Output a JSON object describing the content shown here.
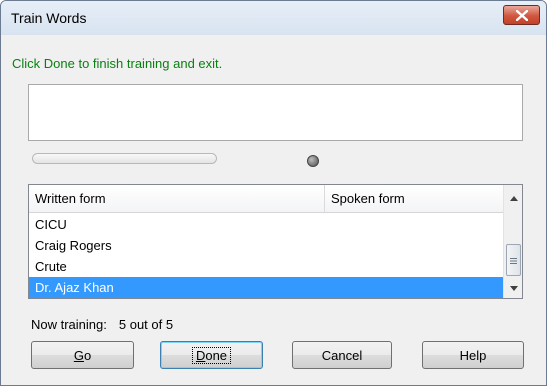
{
  "window": {
    "title": "Train Words"
  },
  "instruction": "Click Done to finish training and exit.",
  "progress": {
    "fill_fraction": 0.0
  },
  "list": {
    "columns": [
      "Written form",
      "Spoken form"
    ],
    "rows": [
      {
        "written": "CICU",
        "spoken": ""
      },
      {
        "written": "Craig Rogers",
        "spoken": ""
      },
      {
        "written": "Crute",
        "spoken": ""
      },
      {
        "written": "Dr. Ajaz Khan",
        "spoken": "",
        "selected": true
      }
    ]
  },
  "status": {
    "label": "Now training:",
    "value": "5 out of 5"
  },
  "buttons": {
    "go": {
      "prefix": "",
      "accel": "G",
      "rest": "o"
    },
    "done": {
      "prefix": "",
      "accel": "D",
      "rest": "one"
    },
    "cancel": "Cancel",
    "help": "Help"
  },
  "colors": {
    "instruction": "#0a7f12",
    "selection": "#3399ff",
    "close_button": "#c3412a"
  },
  "icons": [
    "close-icon",
    "status-light-icon",
    "scroll-up-arrow-icon",
    "scroll-down-arrow-icon",
    "scroll-grip-icon"
  ]
}
